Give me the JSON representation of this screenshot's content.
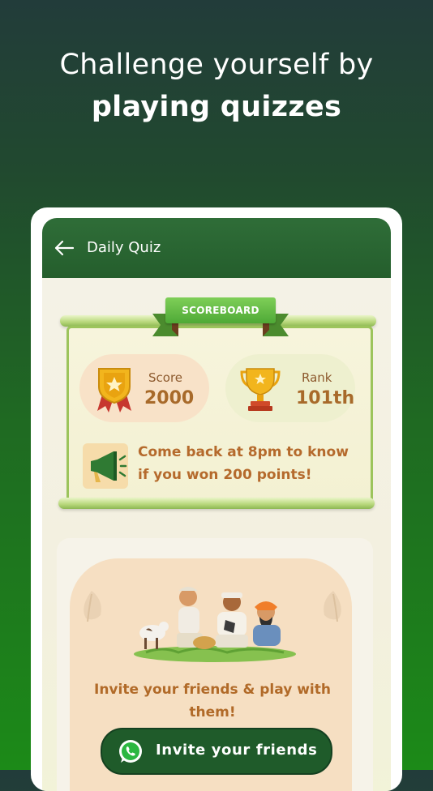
{
  "headline": {
    "line1": "Challenge yourself by",
    "line2": "playing quizzes"
  },
  "appbar": {
    "title": "Daily Quiz",
    "back_icon": "arrow-left-icon"
  },
  "scoreboard": {
    "ribbon_label": "SCOREBOARD",
    "score_label": "Score",
    "score_value": "2000",
    "rank_label": "Rank",
    "rank_value": "101th",
    "message": "Come back at 8pm to know if you won 200 points!",
    "icons": [
      "medal-icon",
      "trophy-icon",
      "megaphone-icon"
    ]
  },
  "invite": {
    "text": "Invite your friends & play with them!",
    "button_label": "Invite your friends",
    "button_icon": "whatsapp-icon"
  },
  "colors": {
    "appbar": "#2f6d38",
    "accent_text": "#b16a28",
    "button": "#1f5b2a"
  }
}
